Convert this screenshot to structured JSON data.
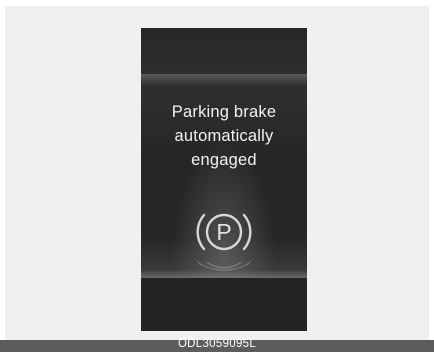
{
  "display": {
    "message_line1": "Parking brake",
    "message_line2": "automatically",
    "message_line3": "engaged",
    "icon": "parking-brake-icon",
    "icon_letter": "P"
  },
  "caption": "ODL3059095L",
  "colors": {
    "page_background": "#f0f0f0",
    "display_background": "#2b2b2b",
    "text": "#f2f2f2",
    "caption_bar": "#5c5c5c"
  }
}
